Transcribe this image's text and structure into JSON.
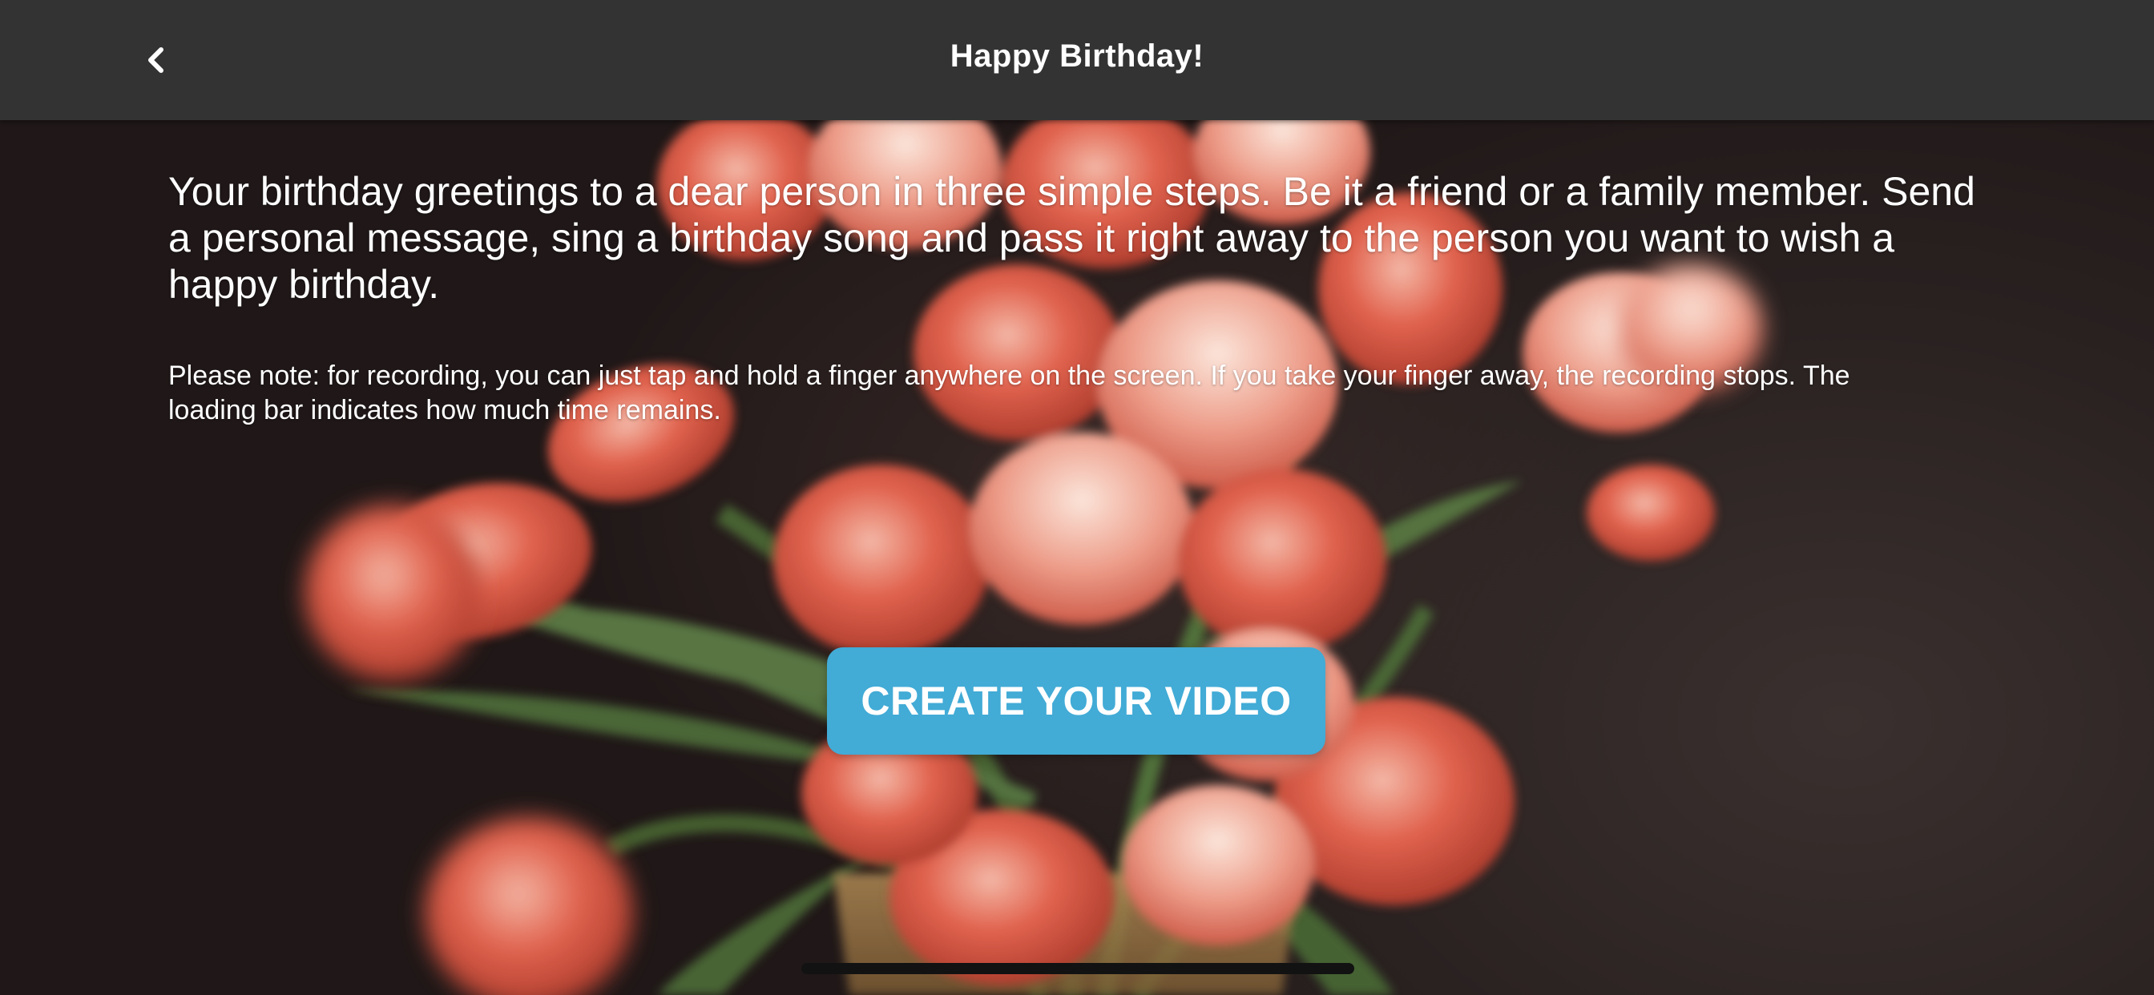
{
  "header": {
    "title": "Happy Birthday!",
    "back_icon": "chevron-left-icon"
  },
  "content": {
    "intro": "Your birthday greetings to a dear person in three simple steps. Be it a friend or a family member. Send a personal message, sing a birthday song and pass it right away to the person you want to wish a happy birthday.",
    "note": "Please note: for recording, you can just tap and hold a finger anywhere on the screen. If you take your finger away, the recording stops. The loading bar indicates how much time remains."
  },
  "cta": {
    "label": "CREATE YOUR VIDEO"
  },
  "colors": {
    "header_bg": "#333333",
    "accent": "#42abd6",
    "text": "#ffffff"
  }
}
